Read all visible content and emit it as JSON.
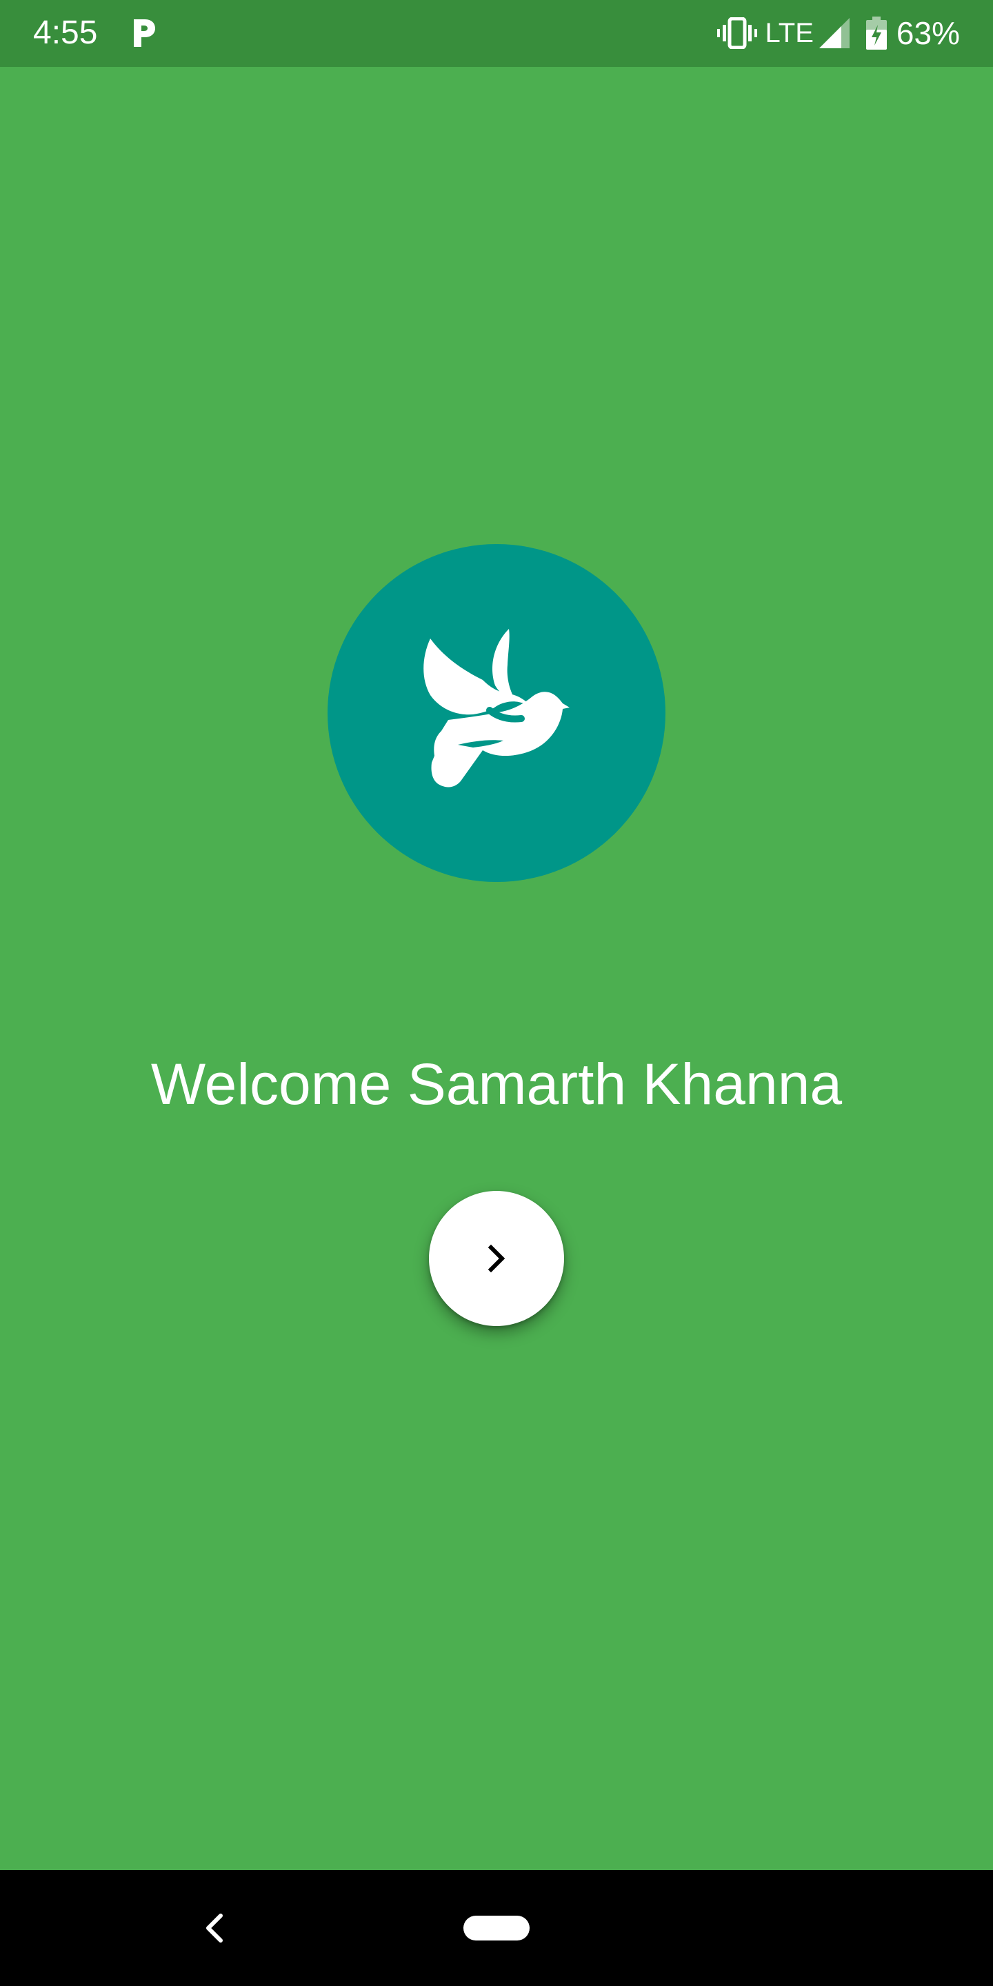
{
  "status_bar": {
    "time": "4:55",
    "app_icon": "parking-p-icon",
    "vibrate_icon": "vibrate-icon",
    "network": "LTE",
    "signal_icon": "signal-icon",
    "battery_icon": "battery-charging-icon",
    "battery": "63%",
    "background": "#388e3c"
  },
  "main": {
    "background": "#4caf50",
    "logo": {
      "icon": "dove-icon",
      "circle_color": "#009688"
    },
    "welcome_text": "Welcome Samarth Khanna",
    "next_button": {
      "icon": "chevron-right-icon"
    }
  },
  "nav_bar": {
    "back_icon": "back-chevron-icon",
    "home_icon": "home-pill"
  }
}
